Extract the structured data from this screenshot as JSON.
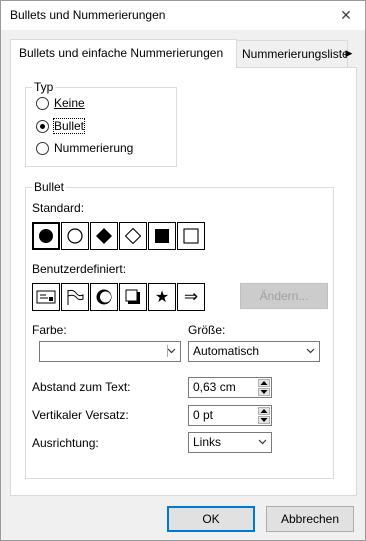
{
  "window": {
    "title": "Bullets und Nummerierungen",
    "close_glyph": "✕"
  },
  "tabs": [
    {
      "label": "Bullets und einfache Nummerierungen",
      "active": true
    },
    {
      "label": "Nummerierungsliste",
      "active": false
    }
  ],
  "tab_scroll_glyph": "▶",
  "typ": {
    "legend": "Typ",
    "options": [
      {
        "label": "Keine",
        "selected": false
      },
      {
        "label": "Bullet",
        "selected": true
      },
      {
        "label": "Nummerierung",
        "selected": false
      }
    ]
  },
  "bullet": {
    "legend": "Bullet",
    "standard_label": "Standard:",
    "standard_symbols": [
      "filled-circle",
      "hollow-circle",
      "filled-diamond",
      "hollow-diamond",
      "filled-square",
      "hollow-square"
    ],
    "custom_label": "Benutzerdefiniert:",
    "custom_symbols": [
      "card-icon",
      "flag-icon",
      "crescent-circle-icon",
      "shadow-square-icon",
      "★",
      "⇒"
    ],
    "change_button": "Ändern...",
    "farbe_label": "Farbe:",
    "farbe_value": "",
    "groesse_label": "Größe:",
    "groesse_value": "Automatisch",
    "abstand_label": "Abstand zum Text:",
    "abstand_value": "0,63 cm",
    "versatz_label": "Vertikaler Versatz:",
    "versatz_value": "0 pt",
    "ausrichtung_label": "Ausrichtung:",
    "ausrichtung_value": "Links"
  },
  "footer": {
    "ok": "OK",
    "cancel": "Abbrechen"
  }
}
